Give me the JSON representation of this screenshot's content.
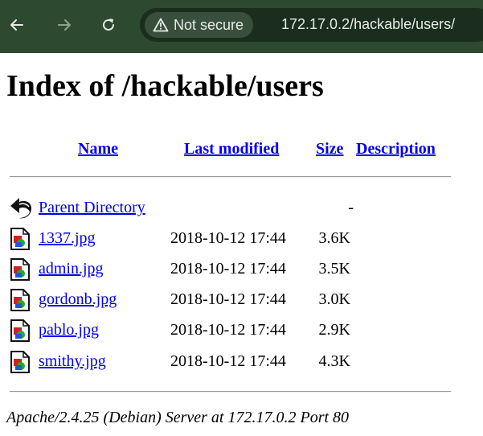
{
  "browser": {
    "security_label": "Not secure",
    "url": "172.17.0.2/hackable/users/",
    "toolbar_color": "#2d4a30",
    "icons": [
      "back-icon",
      "forward-icon",
      "reload-icon",
      "warning-icon"
    ]
  },
  "page": {
    "title": "Index of /hackable/users",
    "columns": {
      "name": "Name",
      "last_modified": "Last modified",
      "size": "Size",
      "description": "Description"
    },
    "parent": {
      "name": "Parent Directory",
      "modified": "",
      "size": "-",
      "icon": "back-arrow-icon"
    },
    "files": [
      {
        "name": "1337.jpg",
        "modified": "2018-10-12 17:44",
        "size": "3.6K",
        "icon": "image-file-icon"
      },
      {
        "name": "admin.jpg",
        "modified": "2018-10-12 17:44",
        "size": "3.5K",
        "icon": "image-file-icon"
      },
      {
        "name": "gordonb.jpg",
        "modified": "2018-10-12 17:44",
        "size": "3.0K",
        "icon": "image-file-icon"
      },
      {
        "name": "pablo.jpg",
        "modified": "2018-10-12 17:44",
        "size": "2.9K",
        "icon": "image-file-icon"
      },
      {
        "name": "smithy.jpg",
        "modified": "2018-10-12 17:44",
        "size": "4.3K",
        "icon": "image-file-icon"
      }
    ],
    "footer": "Apache/2.4.25 (Debian) Server at 172.17.0.2 Port 80",
    "link_color": "#0000ee"
  }
}
